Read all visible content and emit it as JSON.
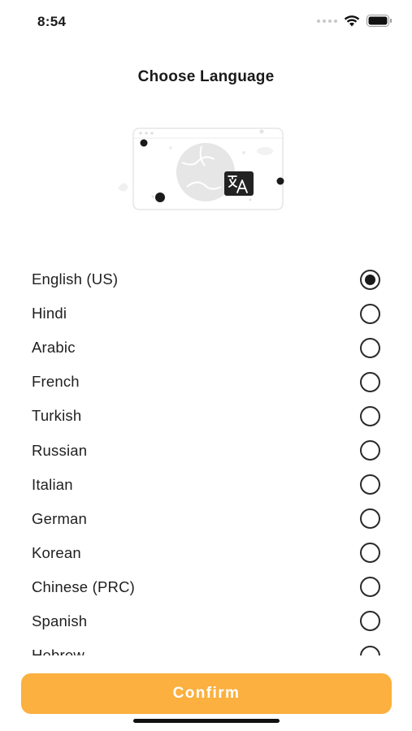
{
  "status_bar": {
    "time": "8:54"
  },
  "header": {
    "title": "Choose Language"
  },
  "languages": [
    {
      "label": "English (US)",
      "selected": true
    },
    {
      "label": "Hindi",
      "selected": false
    },
    {
      "label": "Arabic",
      "selected": false
    },
    {
      "label": "French",
      "selected": false
    },
    {
      "label": "Turkish",
      "selected": false
    },
    {
      "label": "Russian",
      "selected": false
    },
    {
      "label": "Italian",
      "selected": false
    },
    {
      "label": "German",
      "selected": false
    },
    {
      "label": "Korean",
      "selected": false
    },
    {
      "label": "Chinese (PRC)",
      "selected": false
    },
    {
      "label": "Spanish",
      "selected": false
    },
    {
      "label": "Hebrew",
      "selected": false
    }
  ],
  "footer": {
    "confirm_label": "Confirm"
  },
  "colors": {
    "accent": "#fbb040",
    "text": "#1a1a1a"
  },
  "icons": [
    "signal-icon",
    "wifi-icon",
    "battery-icon",
    "translate-icon",
    "globe-icon"
  ]
}
